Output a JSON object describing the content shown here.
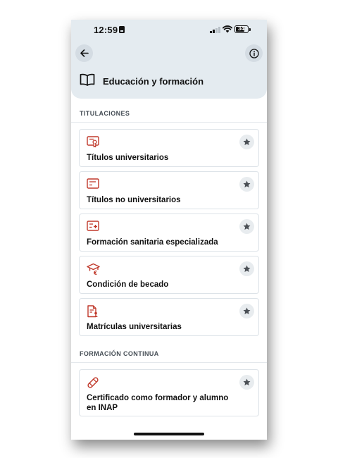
{
  "status_bar": {
    "time": "12:59",
    "battery": "34"
  },
  "header": {
    "title": "Educación y formación"
  },
  "sections": [
    {
      "label": "TITULACIONES",
      "items": [
        {
          "label": "Títulos universitarios",
          "icon": "diploma-icon"
        },
        {
          "label": "Títulos no universitarios",
          "icon": "certificate-card-icon"
        },
        {
          "label": "Formación sanitaria especializada",
          "icon": "medical-certificate-icon"
        },
        {
          "label": "Condición de becado",
          "icon": "graduation-cap-euro-icon"
        },
        {
          "label": "Matrículas universitarias",
          "icon": "enrollment-document-icon"
        }
      ]
    },
    {
      "label": "FORMACIÓN CONTINUA",
      "items": [
        {
          "label": "Certificado como formador y alumno en INAP",
          "icon": "rolled-diploma-icon"
        }
      ]
    }
  ],
  "colors": {
    "accent": "#c0392b",
    "header_bg": "#e4ebf0"
  }
}
